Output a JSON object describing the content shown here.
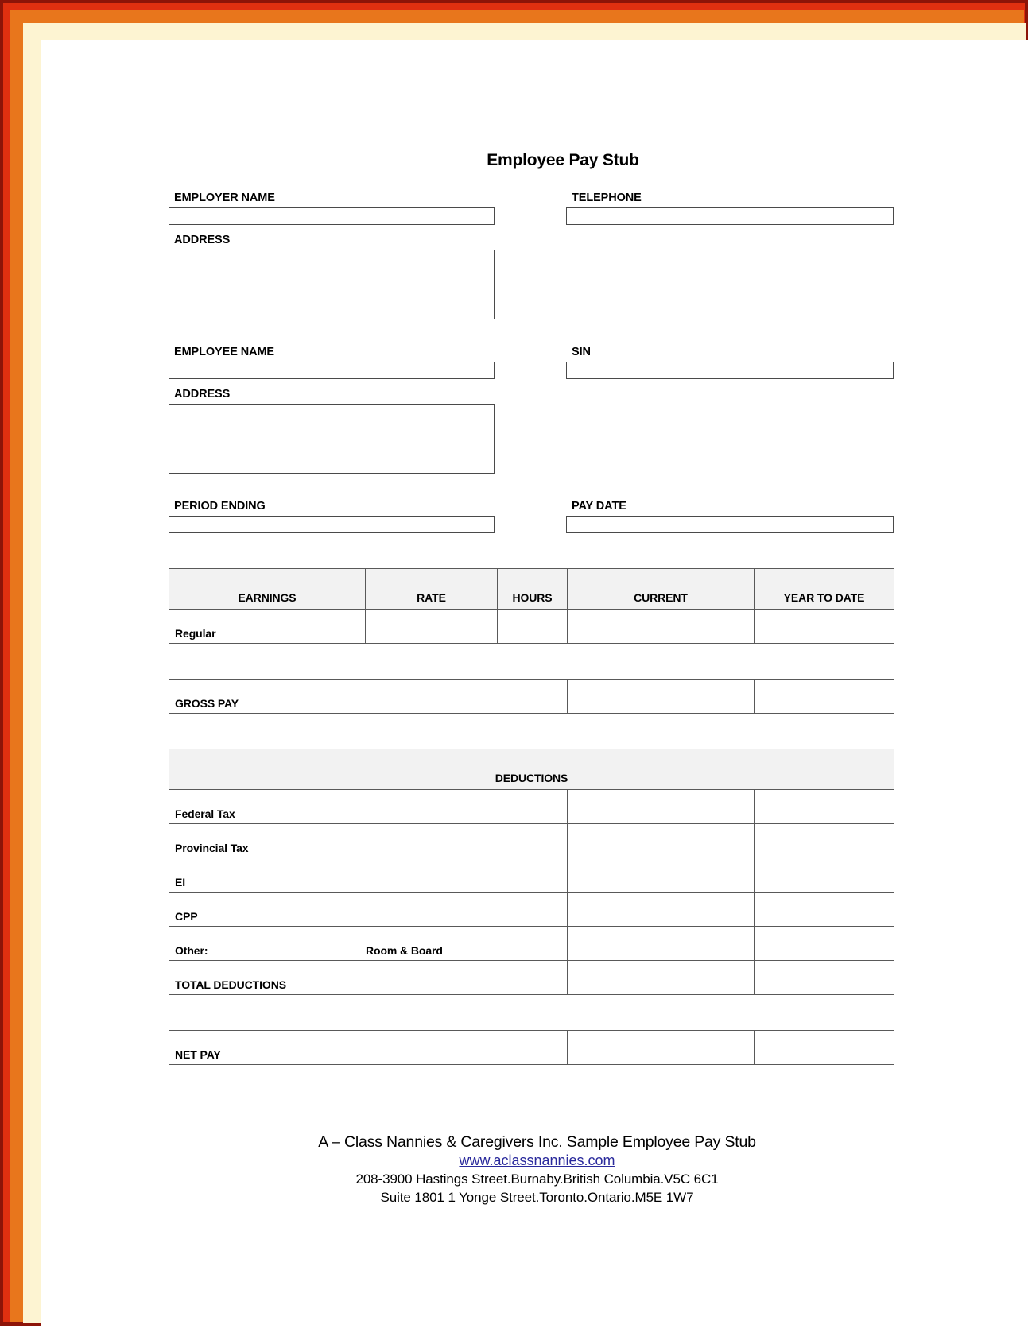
{
  "document": {
    "title": "Employee Pay Stub"
  },
  "employer": {
    "name_label": "EMPLOYER NAME",
    "name_value": "",
    "telephone_label": "TELEPHONE",
    "telephone_value": "",
    "address_label": "ADDRESS",
    "address_value": ""
  },
  "employee": {
    "name_label": "EMPLOYEE NAME",
    "name_value": "",
    "sin_label": "SIN",
    "sin_value": "",
    "address_label": "ADDRESS",
    "address_value": ""
  },
  "period": {
    "period_ending_label": "PERIOD ENDING",
    "period_ending_value": "",
    "pay_date_label": "PAY DATE",
    "pay_date_value": ""
  },
  "earnings": {
    "headers": [
      "EARNINGS",
      "RATE",
      "HOURS",
      "CURRENT",
      "YEAR TO DATE"
    ],
    "rows": [
      {
        "label": "Regular",
        "rate": "",
        "hours": "",
        "current": "",
        "ytd": ""
      }
    ]
  },
  "gross_pay": {
    "label": "GROSS PAY",
    "current": "",
    "ytd": ""
  },
  "deductions": {
    "header": "DEDUCTIONS",
    "rows": [
      {
        "label": "Federal Tax",
        "sub": "",
        "current": "",
        "ytd": ""
      },
      {
        "label": "Provincial Tax",
        "sub": "",
        "current": "",
        "ytd": ""
      },
      {
        "label": "EI",
        "sub": "",
        "current": "",
        "ytd": ""
      },
      {
        "label": "CPP",
        "sub": "",
        "current": "",
        "ytd": ""
      },
      {
        "label": "Other:",
        "sub": "Room & Board",
        "current": "",
        "ytd": ""
      },
      {
        "label": "TOTAL DEDUCTIONS",
        "sub": "",
        "current": "",
        "ytd": ""
      }
    ]
  },
  "net_pay": {
    "label": "NET PAY",
    "current": "",
    "ytd": ""
  },
  "footer": {
    "company_line": "A – Class Nannies & Caregivers Inc. Sample Employee Pay Stub",
    "website": "www.aclassnannies.com",
    "address_line_1": "208-3900 Hastings Street.Burnaby.British Columbia.V5C 6C1",
    "address_line_2": "Suite 1801 1 Yonge Street.Toronto.Ontario.M5E 1W7"
  },
  "colors": {
    "border_outer": "#8d1408",
    "border_red": "#e03010",
    "border_orange": "#e8761c",
    "border_cream": "#fdf4d2",
    "table_header_bg": "#f2f2f2",
    "link": "#2a2a9c"
  }
}
